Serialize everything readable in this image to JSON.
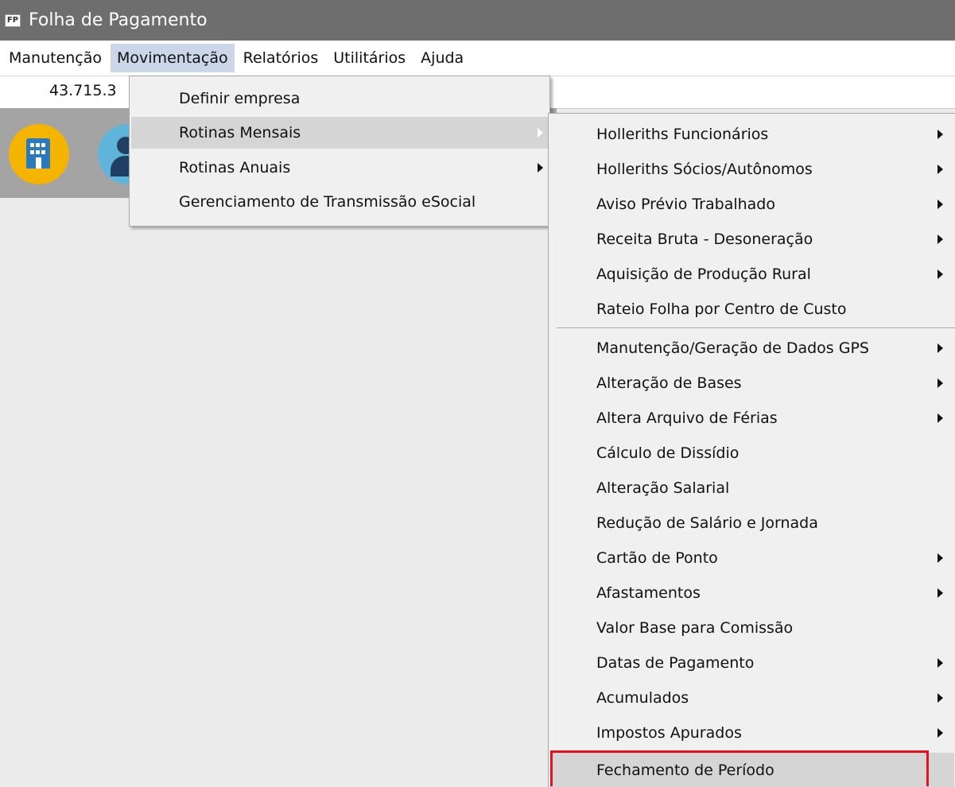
{
  "window": {
    "icon_text": "FP",
    "title": "Folha de Pagamento"
  },
  "menubar": {
    "items": [
      {
        "label": "Manutenção"
      },
      {
        "label": "Movimentação"
      },
      {
        "label": "Relatórios"
      },
      {
        "label": "Utilitários"
      },
      {
        "label": "Ajuda"
      }
    ],
    "active": "Movimentação"
  },
  "company": {
    "value": "43.715.3"
  },
  "toolbar": {
    "icons": [
      "building-icon",
      "person-icon"
    ]
  },
  "movimentacao_menu": {
    "items": [
      {
        "label": "Definir empresa",
        "submenu": false
      },
      {
        "label": "Rotinas Mensais",
        "submenu": true,
        "highlighted": true
      },
      {
        "label": "Rotinas Anuais",
        "submenu": true
      },
      {
        "label": "Gerenciamento de Transmissão eSocial",
        "submenu": false
      }
    ]
  },
  "rotinas_mensais_menu": {
    "items": [
      {
        "label": "Holleriths Funcionários",
        "submenu": true
      },
      {
        "label": "Holleriths Sócios/Autônomos",
        "submenu": true
      },
      {
        "label": "Aviso Prévio Trabalhado",
        "submenu": true
      },
      {
        "label": "Receita Bruta - Desoneração",
        "submenu": true
      },
      {
        "label": "Aquisição de Produção Rural",
        "submenu": true
      },
      {
        "label": "Rateio Folha por Centro de Custo",
        "submenu": false
      },
      {
        "label": "Manutenção/Geração de Dados GPS",
        "submenu": true
      },
      {
        "label": "Alteração de Bases",
        "submenu": true
      },
      {
        "label": "Altera Arquivo de Férias",
        "submenu": true
      },
      {
        "label": "Cálculo de Dissídio",
        "submenu": false
      },
      {
        "label": "Alteração Salarial",
        "submenu": false
      },
      {
        "label": "Redução de Salário e Jornada",
        "submenu": false
      },
      {
        "label": "Cartão de Ponto",
        "submenu": true
      },
      {
        "label": "Afastamentos",
        "submenu": true
      },
      {
        "label": "Valor Base para Comissão",
        "submenu": false
      },
      {
        "label": "Datas de Pagamento",
        "submenu": true
      },
      {
        "label": "Acumulados",
        "submenu": true
      },
      {
        "label": "Impostos Apurados",
        "submenu": true
      },
      {
        "label": "Fechamento de Período",
        "submenu": false,
        "highlighted": true
      }
    ]
  },
  "colors": {
    "titlebar": "#6e6e6e",
    "menu_active": "#cbd7e8",
    "menu_highlight": "#d5d5d5",
    "annotation_box": "#e8111a",
    "toolbar_bg": "#a4a4a4"
  }
}
